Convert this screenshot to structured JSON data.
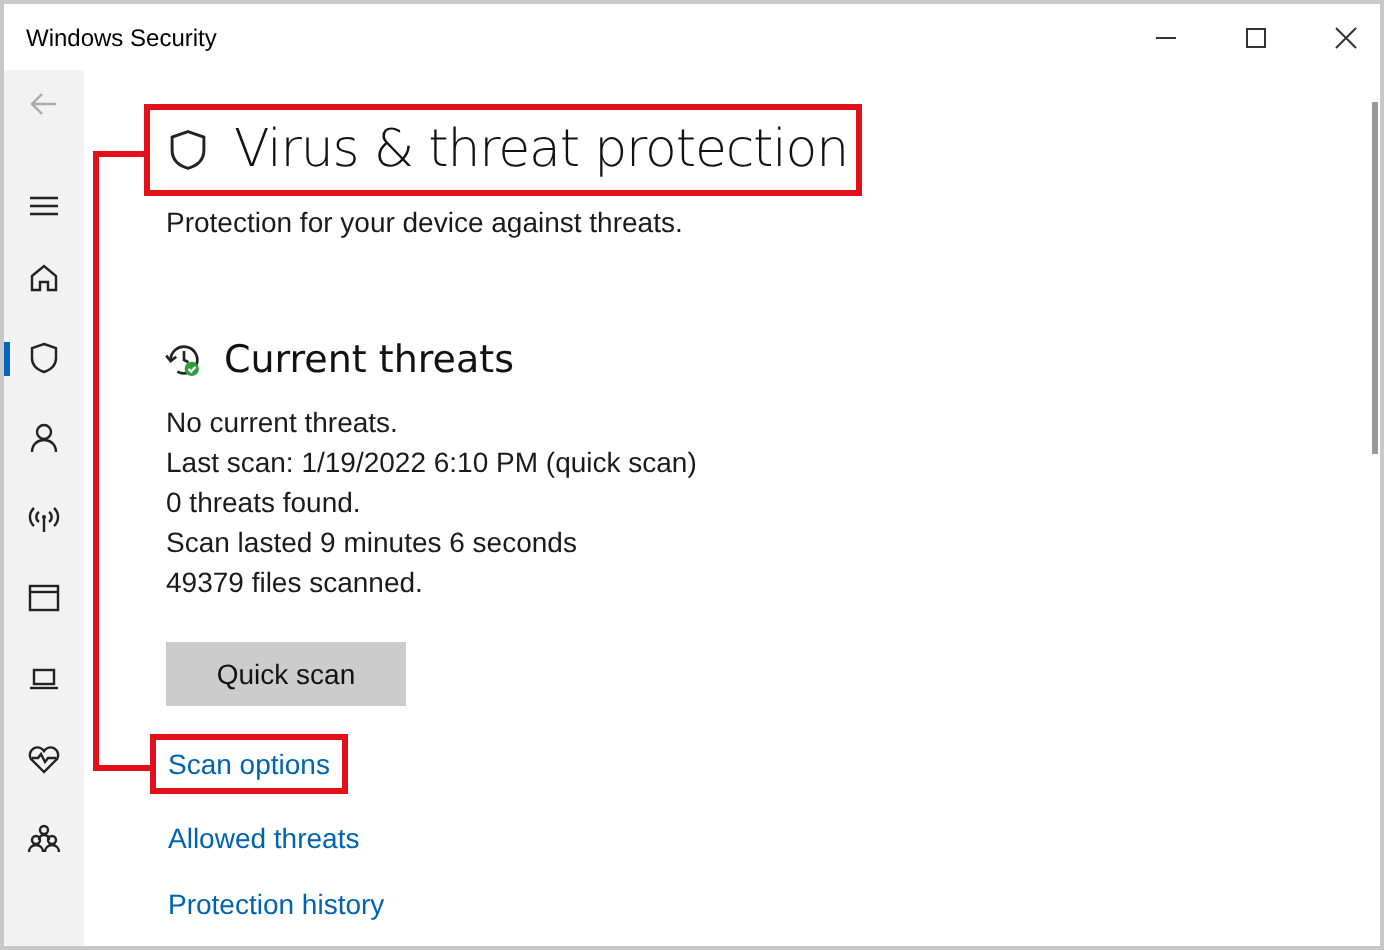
{
  "window": {
    "title": "Windows Security"
  },
  "sidebar": {
    "back_button": {
      "disabled": true
    },
    "items": [
      {
        "selected": false
      },
      {
        "selected": false
      },
      {
        "selected": true
      },
      {
        "selected": false
      },
      {
        "selected": false
      },
      {
        "selected": false
      },
      {
        "selected": false
      },
      {
        "selected": false
      },
      {
        "selected": false
      }
    ]
  },
  "page": {
    "title": "Virus & threat protection",
    "highlighted": true,
    "subtitle": "Protection for your device against threats."
  },
  "current_threats": {
    "title": "Current threats",
    "lines": [
      "No current threats.",
      "Last scan: 1/19/2022 6:10 PM (quick scan)",
      "0 threats found.",
      "Scan lasted 9 minutes 6 seconds",
      "49379 files scanned."
    ],
    "button": "Quick scan",
    "links": [
      {
        "label": "Scan options",
        "highlighted": true
      },
      {
        "label": "Allowed threats",
        "highlighted": false
      },
      {
        "label": "Protection history",
        "highlighted": false
      }
    ]
  }
}
